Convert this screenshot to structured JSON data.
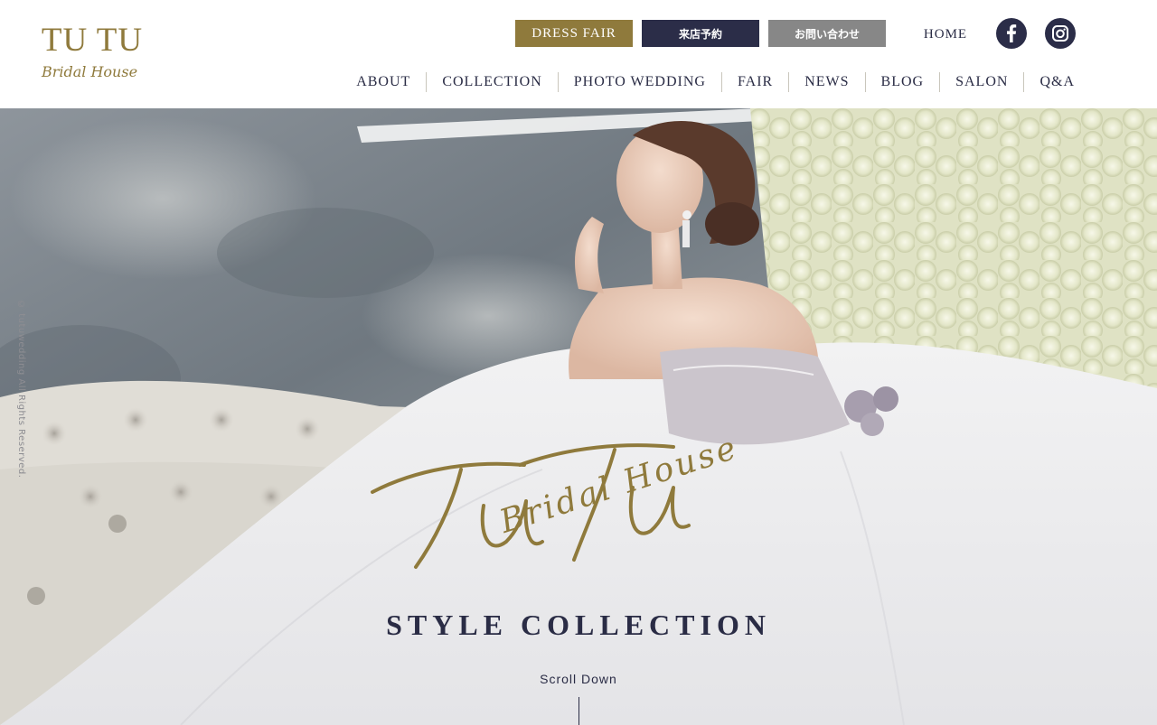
{
  "brand": {
    "logo_main": "TU TU",
    "logo_sub": "Bridal House"
  },
  "header": {
    "buttons": {
      "dress_fair": "DRESS FAIR",
      "reservation": "来店予約",
      "contact": "お問い合わせ"
    },
    "home": "HOME",
    "social": [
      {
        "name": "facebook-icon"
      },
      {
        "name": "instagram-icon"
      }
    ]
  },
  "nav": {
    "items": [
      {
        "label": "ABOUT"
      },
      {
        "label": "COLLECTION"
      },
      {
        "label": "PHOTO WEDDING"
      },
      {
        "label": "FAIR"
      },
      {
        "label": "NEWS"
      },
      {
        "label": "BLOG"
      },
      {
        "label": "SALON"
      },
      {
        "label": "Q&A"
      }
    ]
  },
  "hero": {
    "copyright": "© tutuwedding All Rights Reserved.",
    "script_title": "TuTu",
    "script_subtitle": "Bridal House",
    "heading": "STYLE COLLECTION",
    "scroll": "Scroll Down"
  },
  "colors": {
    "gold": "#8f7a3c",
    "navy": "#2b2d48",
    "gray": "#878787"
  }
}
